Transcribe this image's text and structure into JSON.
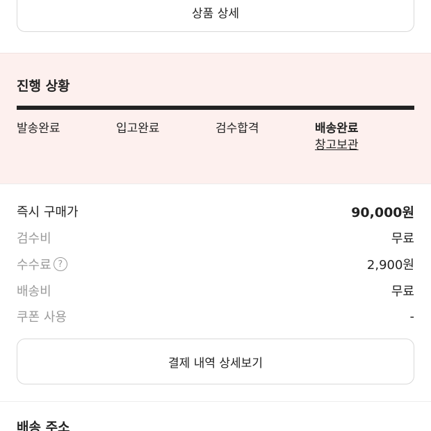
{
  "product_detail_button": {
    "label": "상품 상세"
  },
  "progress": {
    "title": "진행 상황",
    "steps": [
      {
        "label": "발송완료"
      },
      {
        "label": "입고완료"
      },
      {
        "label": "검수합격"
      },
      {
        "label": "배송완료",
        "sub": "창고보관"
      }
    ]
  },
  "price": {
    "rows": [
      {
        "label": "즉시 구매가",
        "value": "90,000원"
      },
      {
        "label": "검수비",
        "value": "무료"
      },
      {
        "label": "수수료",
        "value": "2,900원",
        "help_icon": "question-circle-icon"
      },
      {
        "label": "배송비",
        "value": "무료"
      },
      {
        "label": "쿠폰 사용",
        "value": "-"
      }
    ],
    "detail_button": "결제 내역 상세보기"
  },
  "address": {
    "title": "배송 주소"
  },
  "colors": {
    "progress_bg": "#fdf0ee",
    "text": "#222222",
    "muted": "#9a9a9a"
  }
}
